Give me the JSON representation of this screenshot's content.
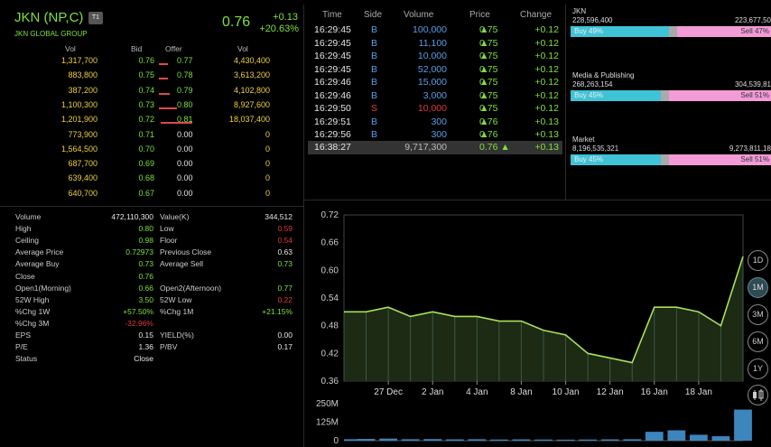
{
  "header": {
    "symbol": "JKN (NP,C)",
    "board_badge": "T1",
    "company_name": "JKN GLOBAL GROUP",
    "last": "0.76",
    "change": "+0.13",
    "percent_change": "+20.63%"
  },
  "orderbook": {
    "headers": {
      "bid_vol": "Vol",
      "bid": "Bid",
      "offer": "Offer",
      "offer_vol": "Vol"
    },
    "rows": [
      {
        "bid_vol": "1,317,700",
        "bid": "0.76",
        "offer": "0.77",
        "offer_vol": "4,430,400",
        "bid_color": "green",
        "offer_color": "green"
      },
      {
        "bid_vol": "883,800",
        "bid": "0.75",
        "offer": "0.78",
        "offer_vol": "3,613,200",
        "bid_color": "green",
        "offer_color": "green"
      },
      {
        "bid_vol": "387,200",
        "bid": "0.74",
        "offer": "0.79",
        "offer_vol": "4,102,800",
        "bid_color": "green",
        "offer_color": "green"
      },
      {
        "bid_vol": "1,100,300",
        "bid": "0.73",
        "offer": "0.80",
        "offer_vol": "8,927,600",
        "bid_color": "green",
        "offer_color": "green"
      },
      {
        "bid_vol": "1,201,900",
        "bid": "0.72",
        "offer": "0.81",
        "offer_vol": "18,037,400",
        "bid_color": "green",
        "offer_color": "green"
      },
      {
        "bid_vol": "773,900",
        "bid": "0.71",
        "offer": "0.00",
        "offer_vol": "0",
        "bid_color": "green",
        "offer_color": "white"
      },
      {
        "bid_vol": "1,564,500",
        "bid": "0.70",
        "offer": "0.00",
        "offer_vol": "0",
        "bid_color": "green",
        "offer_color": "white"
      },
      {
        "bid_vol": "687,700",
        "bid": "0.69",
        "offer": "0.00",
        "offer_vol": "0",
        "bid_color": "green",
        "offer_color": "white"
      },
      {
        "bid_vol": "639,400",
        "bid": "0.68",
        "offer": "0.00",
        "offer_vol": "0",
        "bid_color": "green",
        "offer_color": "white"
      },
      {
        "bid_vol": "640,700",
        "bid": "0.67",
        "offer": "0.00",
        "offer_vol": "0",
        "bid_color": "green",
        "offer_color": "white"
      }
    ]
  },
  "stats_left": [
    {
      "label": "Volume",
      "value": "472,110,300",
      "color": "white"
    },
    {
      "label": "High",
      "value": "0.80",
      "color": "green"
    },
    {
      "label": "Ceiling",
      "value": "0.98",
      "color": "green"
    },
    {
      "label": "Average Price",
      "value": "0.72973",
      "color": "green"
    },
    {
      "label": "Average Buy",
      "value": "0.73",
      "color": "green"
    },
    {
      "label": "Close",
      "value": "0.76",
      "color": "green"
    },
    {
      "label": "Open1(Morning)",
      "value": "0.66",
      "color": "green"
    },
    {
      "label": "52W High",
      "value": "3.50",
      "color": "green"
    },
    {
      "label": "%Chg 1W",
      "value": "+57.50%",
      "color": "green"
    },
    {
      "label": "%Chg 3M",
      "value": "-32.96%",
      "color": "red"
    },
    {
      "label": "EPS",
      "value": "0.15",
      "color": "white"
    },
    {
      "label": "P/E",
      "value": "1.36",
      "color": "white"
    },
    {
      "label": "Status",
      "value": "Close",
      "color": "white"
    }
  ],
  "stats_right": [
    {
      "label": "Value(K)",
      "value": "344,512",
      "color": "white"
    },
    {
      "label": "Low",
      "value": "0.59",
      "color": "red"
    },
    {
      "label": "Floor",
      "value": "0.54",
      "color": "red"
    },
    {
      "label": "Previous Close",
      "value": "0.63",
      "color": "white"
    },
    {
      "label": "Average Sell",
      "value": "0.73",
      "color": "green"
    },
    {
      "label": "",
      "value": "",
      "color": "white"
    },
    {
      "label": "Open2(Afternoon)",
      "value": "0.77",
      "color": "green"
    },
    {
      "label": "52W Low",
      "value": "0.22",
      "color": "red"
    },
    {
      "label": "%Chg 1M",
      "value": "+21.15%",
      "color": "green"
    },
    {
      "label": "",
      "value": "",
      "color": "white"
    },
    {
      "label": "YIELD(%)",
      "value": "0.00",
      "color": "white"
    },
    {
      "label": "P/BV",
      "value": "0.17",
      "color": "white"
    },
    {
      "label": "",
      "value": "",
      "color": "white"
    }
  ],
  "trades": {
    "headers": {
      "time": "Time",
      "side": "Side",
      "volume": "Volume",
      "price": "Price",
      "change": "Change"
    },
    "rows": [
      {
        "time": "16:29:45",
        "side": "B",
        "volume": "100,000",
        "price": "0.75",
        "change": "+0.12"
      },
      {
        "time": "16:29:45",
        "side": "B",
        "volume": "11,100",
        "price": "0.75",
        "change": "+0.12"
      },
      {
        "time": "16:29:45",
        "side": "B",
        "volume": "10,000",
        "price": "0.75",
        "change": "+0.12"
      },
      {
        "time": "16:29:45",
        "side": "B",
        "volume": "52,000",
        "price": "0.75",
        "change": "+0.12"
      },
      {
        "time": "16:29:46",
        "side": "B",
        "volume": "15,000",
        "price": "0.75",
        "change": "+0.12"
      },
      {
        "time": "16:29:46",
        "side": "B",
        "volume": "3,000",
        "price": "0.75",
        "change": "+0.12"
      },
      {
        "time": "16:29:50",
        "side": "S",
        "volume": "10,000",
        "price": "0.75",
        "change": "+0.12"
      },
      {
        "time": "16:29:51",
        "side": "B",
        "volume": "300",
        "price": "0.76",
        "change": "+0.13"
      },
      {
        "time": "16:29:56",
        "side": "B",
        "volume": "300",
        "price": "0.76",
        "change": "+0.13"
      }
    ],
    "summary": {
      "time": "16:38:27",
      "volume": "9,717,300",
      "price": "0.76",
      "change": "+0.13"
    }
  },
  "flow": [
    {
      "title": "JKN",
      "buy_vol": "228,596,400",
      "sell_vol": "223,677,50",
      "buy_label": "Buy 49%",
      "sell_label": "Sell 47%",
      "buy_pct": 49,
      "sell_pct": 47
    },
    {
      "title": "Media & Publishing",
      "buy_vol": "268,263,154",
      "sell_vol": "304,539,81",
      "buy_label": "Buy 45%",
      "sell_label": "Sell 51%",
      "buy_pct": 45,
      "sell_pct": 51
    },
    {
      "title": "Market",
      "buy_vol": "8,196,535,321",
      "sell_vol": "9,273,811,18",
      "buy_label": "Buy 45%",
      "sell_label": "Sell 51%",
      "buy_pct": 45,
      "sell_pct": 51
    }
  ],
  "timeframes": [
    {
      "label": "1D",
      "active": false
    },
    {
      "label": "1M",
      "active": true
    },
    {
      "label": "3M",
      "active": false
    },
    {
      "label": "6M",
      "active": false
    },
    {
      "label": "1Y",
      "active": false
    }
  ],
  "colors": {
    "up": "#7ee03a",
    "down": "#e03a3a",
    "neutral": "#f1d03c",
    "line": "#a8e05a",
    "area": "#1d2a14",
    "volume": "#3c86bd"
  },
  "chart_data": {
    "type": "line",
    "x": [
      "22 Dec",
      "23 Dec",
      "26 Dec",
      "27 Dec",
      "28 Dec",
      "29 Dec",
      "30 Dec",
      "2 Jan",
      "3 Jan",
      "4 Jan",
      "5 Jan",
      "6 Jan",
      "9 Jan",
      "10 Jan",
      "11 Jan",
      "12 Jan",
      "13 Jan",
      "16 Jan",
      "17 Jan",
      "18 Jan",
      "19 Jan",
      "20 Jan"
    ],
    "xticks": [
      "27 Dec",
      "2 Jan",
      "4 Jan",
      "8 Jan",
      "10 Jan",
      "12 Jan",
      "16 Jan",
      "18 Jan"
    ],
    "series": [
      {
        "values": [
          0.51,
          0.51,
          0.52,
          0.5,
          0.51,
          0.5,
          0.5,
          0.49,
          0.49,
          0.47,
          0.46,
          0.42,
          0.41,
          0.4,
          0.52,
          0.52,
          0.51,
          0.48,
          0.63
        ]
      }
    ],
    "yticks": [
      "0.72",
      "0.66",
      "0.60",
      "0.54",
      "0.48",
      "0.42",
      "0.36"
    ],
    "ylim": [
      0.36,
      0.72
    ],
    "volume": {
      "yticks": [
        "250M",
        "125M",
        "0"
      ],
      "ylim": [
        0,
        250
      ],
      "values": [
        10,
        12,
        14,
        10,
        11,
        9,
        10,
        8,
        9,
        8,
        7,
        8,
        9,
        10,
        60,
        70,
        40,
        30,
        210
      ]
    }
  }
}
